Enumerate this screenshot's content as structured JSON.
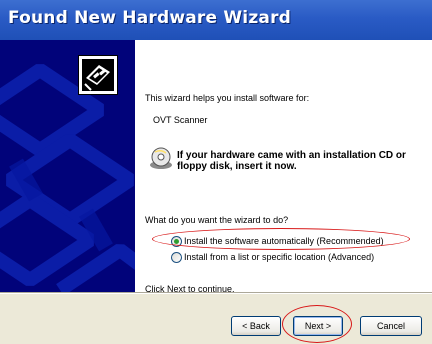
{
  "window": {
    "title": "Found New Hardware Wizard"
  },
  "content": {
    "intro": "This wizard helps you install software for:",
    "device": "OVT Scanner",
    "cd_hint": "If your hardware came with an installation CD or floppy disk, insert it now.",
    "question": "What do you want the wizard to do?",
    "options": [
      {
        "label": "Install the software automatically (Recommended)",
        "selected": true
      },
      {
        "label": "Install from a list or specific location (Advanced)",
        "selected": false
      }
    ],
    "continue_text": "Click Next to continue."
  },
  "buttons": {
    "back": "< Back",
    "next": "Next >",
    "cancel": "Cancel"
  },
  "colors": {
    "titlebar": "#2a5bc5",
    "banner": "#01037a",
    "annotation": "#d81818",
    "selected_radio": "#2f9d2f"
  },
  "icons": [
    "wizard-hardware-icon",
    "cd-icon",
    "radio-selected-icon",
    "radio-unselected-icon"
  ]
}
